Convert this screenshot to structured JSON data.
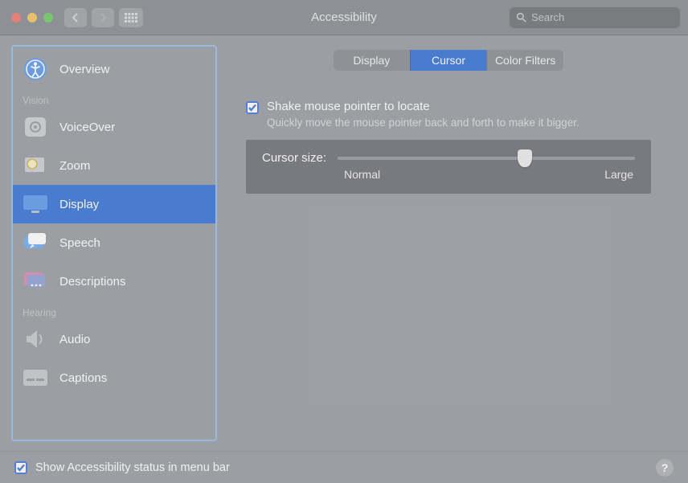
{
  "window": {
    "title": "Accessibility",
    "search_placeholder": "Search"
  },
  "sidebar": {
    "sections": [
      {
        "label": ""
      },
      {
        "label": "Vision"
      },
      {
        "label": "Hearing"
      }
    ],
    "items": [
      {
        "label": "Overview",
        "section": 0
      },
      {
        "label": "VoiceOver",
        "section": 1
      },
      {
        "label": "Zoom",
        "section": 1
      },
      {
        "label": "Display",
        "section": 1,
        "selected": true
      },
      {
        "label": "Speech",
        "section": 1
      },
      {
        "label": "Descriptions",
        "section": 1
      },
      {
        "label": "Audio",
        "section": 2
      },
      {
        "label": "Captions",
        "section": 2
      }
    ]
  },
  "tabs": {
    "items": [
      "Display",
      "Cursor",
      "Color Filters"
    ],
    "selected": 1
  },
  "shake": {
    "checked": true,
    "label": "Shake mouse pointer to locate",
    "description": "Quickly move the mouse pointer back and forth to make it bigger."
  },
  "cursor_size": {
    "label": "Cursor size:",
    "min_label": "Normal",
    "max_label": "Large",
    "value_pct": 63
  },
  "footer": {
    "checked": true,
    "label": "Show Accessibility status in menu bar",
    "help_label": "?"
  }
}
